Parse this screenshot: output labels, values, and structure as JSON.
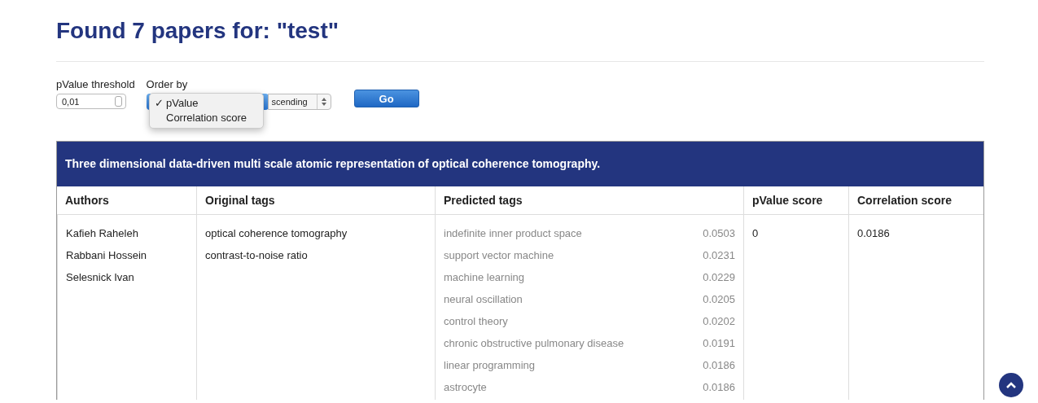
{
  "title": "Found 7 papers for: \"test\"",
  "filters": {
    "threshold": {
      "label": "pValue threshold",
      "value": "0,01"
    },
    "order_by": {
      "label": "Order by",
      "marker": "✓",
      "expanded": true,
      "options": [
        {
          "label": "pValue",
          "selected": true
        },
        {
          "label": "Correlation score",
          "selected": false
        }
      ]
    },
    "direction": {
      "value": "scending"
    },
    "go_button": "Go"
  },
  "papers": [
    {
      "title": "Three dimensional data-driven multi scale atomic representation of optical coherence tomography.",
      "columns": [
        "Authors",
        "Original tags",
        "Predicted tags",
        "pValue score",
        "Correlation score"
      ],
      "authors": [
        "Kafieh Raheleh",
        "Rabbani Hossein",
        "Selesnick Ivan"
      ],
      "original_tags": [
        "optical coherence tomography",
        "contrast-to-noise ratio"
      ],
      "predicted_tags": [
        {
          "name": "indefinite inner product space",
          "score": "0.0503"
        },
        {
          "name": "support vector machine",
          "score": "0.0231"
        },
        {
          "name": "machine learning",
          "score": "0.0229"
        },
        {
          "name": "neural oscillation",
          "score": "0.0205"
        },
        {
          "name": "control theory",
          "score": "0.0202"
        },
        {
          "name": "chronic obstructive pulmonary disease",
          "score": "0.0191"
        },
        {
          "name": "linear programming",
          "score": "0.0186"
        },
        {
          "name": "astrocyte",
          "score": "0.0186"
        }
      ],
      "pvalue_score": "0",
      "correlation_score": "0.0186"
    }
  ]
}
